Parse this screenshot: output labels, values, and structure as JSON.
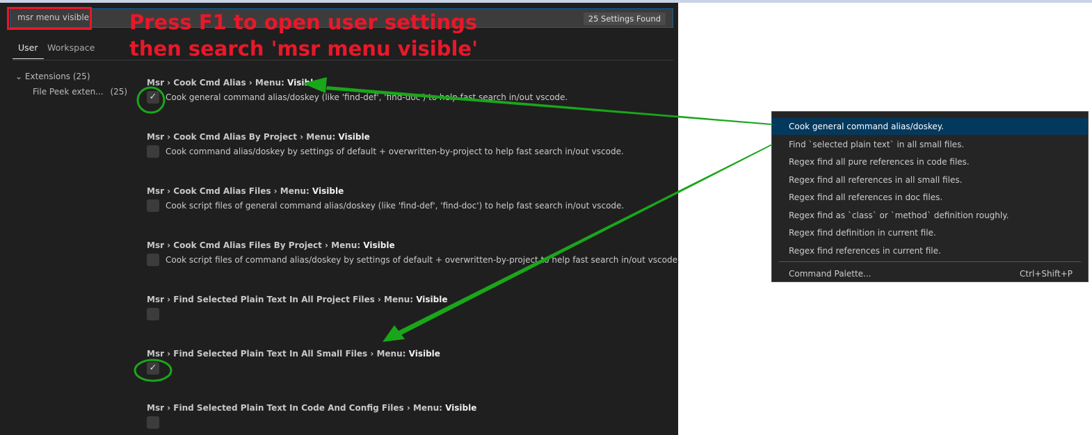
{
  "search": {
    "value": "msr menu visible",
    "results_badge": "25 Settings Found"
  },
  "annotation": {
    "line1": "Press F1 to open user settings",
    "line2": "then search 'msr menu visible'"
  },
  "tabs": [
    {
      "label": "User",
      "active": true
    },
    {
      "label": "Workspace",
      "active": false
    }
  ],
  "tree": {
    "group": "Extensions (25)",
    "child": "File Peek exten...",
    "child_count": "(25)"
  },
  "settings": [
    {
      "prefix": "Msr › Cook Cmd Alias › Menu: ",
      "key": "Visible",
      "checked": true,
      "description": "Cook general command alias/doskey (like 'find-def', 'find-doc') to help fast search in/out vscode."
    },
    {
      "prefix": "Msr › Cook Cmd Alias By Project › Menu: ",
      "key": "Visible",
      "checked": false,
      "description": "Cook command alias/doskey by settings of default + overwritten-by-project to help fast search in/out vscode."
    },
    {
      "prefix": "Msr › Cook Cmd Alias Files › Menu: ",
      "key": "Visible",
      "checked": false,
      "description": "Cook script files of general command alias/doskey (like 'find-def', 'find-doc') to help fast search in/out vscode."
    },
    {
      "prefix": "Msr › Cook Cmd Alias Files By Project › Menu: ",
      "key": "Visible",
      "checked": false,
      "description": "Cook script files of command alias/doskey by settings of default + overwritten-by-project to help fast search in/out vscode."
    },
    {
      "prefix": "Msr › Find Selected Plain Text In All Project Files › Menu: ",
      "key": "Visible",
      "checked": false,
      "description": ""
    },
    {
      "prefix": "Msr › Find Selected Plain Text In All Small Files › Menu: ",
      "key": "Visible",
      "checked": true,
      "description": ""
    },
    {
      "prefix": "Msr › Find Selected Plain Text In Code And Config Files › Menu: ",
      "key": "Visible",
      "checked": false,
      "description": ""
    }
  ],
  "context_menu": {
    "items": [
      {
        "label": "Cook general command alias/doskey.",
        "selected": true
      },
      {
        "label": "Find `selected plain text` in all small files.",
        "selected": false
      },
      {
        "label": "Regex find all pure references in code files.",
        "selected": false
      },
      {
        "label": "Regex find all references in all small files.",
        "selected": false
      },
      {
        "label": "Regex find all references in doc files.",
        "selected": false
      },
      {
        "label": "Regex find as `class` or `method` definition roughly.",
        "selected": false
      },
      {
        "label": "Regex find definition in current file.",
        "selected": false
      },
      {
        "label": "Regex find references in current file.",
        "selected": false
      }
    ],
    "command_palette": {
      "label": "Command Palette...",
      "shortcut": "Ctrl+Shift+P"
    }
  },
  "colors": {
    "annotation_red": "#e8182a",
    "annotation_green": "#1aa61a",
    "menu_selection": "#04395e",
    "panel_bg": "#1f1f1f"
  }
}
